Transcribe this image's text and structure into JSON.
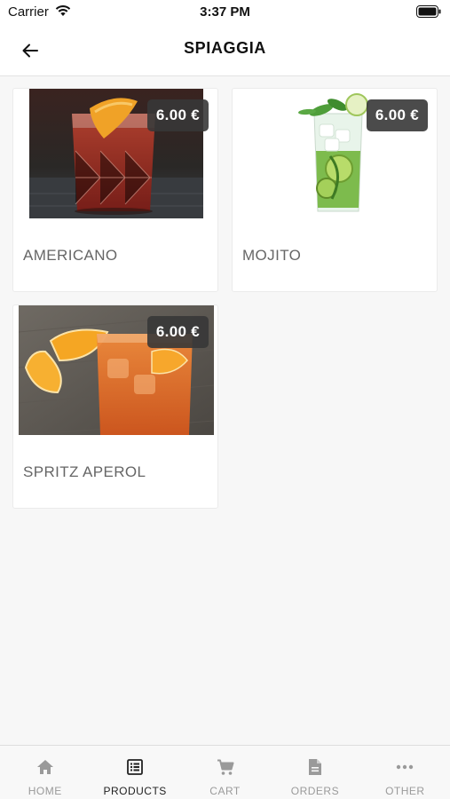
{
  "status_bar": {
    "carrier": "Carrier",
    "time": "3:37 PM"
  },
  "header": {
    "title": "SPIAGGIA"
  },
  "products": [
    {
      "name": "AMERICANO",
      "price": "6.00 €",
      "image": "americano-cocktail"
    },
    {
      "name": "MOJITO",
      "price": "6.00 €",
      "image": "mojito-cocktail"
    },
    {
      "name": "SPRITZ APEROL",
      "price": "6.00 €",
      "image": "spritz-aperol-cocktail"
    }
  ],
  "tabs": [
    {
      "label": "HOME",
      "icon": "home-icon",
      "active": false
    },
    {
      "label": "PRODUCTS",
      "icon": "list-icon",
      "active": true
    },
    {
      "label": "CART",
      "icon": "cart-icon",
      "active": false
    },
    {
      "label": "ORDERS",
      "icon": "document-icon",
      "active": false
    },
    {
      "label": "OTHER",
      "icon": "more-icon",
      "active": false
    }
  ],
  "colors": {
    "price_badge": "#373737",
    "active_tab": "#222222",
    "inactive_tab": "#9a9a9a",
    "background": "#f7f7f7"
  }
}
